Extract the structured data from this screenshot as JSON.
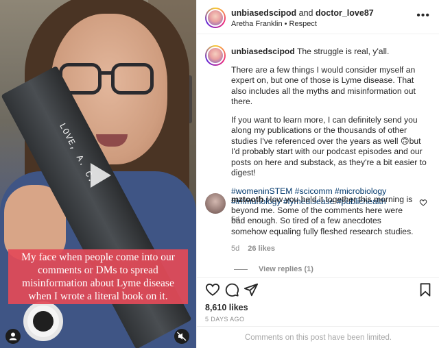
{
  "video": {
    "book_spine_text": "LOVE, A. C.",
    "caption_lines": [
      "My face when people come into our",
      "comments or DMs to spread",
      "misinformation about Lyme disease",
      "when I wrote a literal book on it."
    ]
  },
  "header": {
    "author_1": "unbiasedscipod",
    "joiner": " and ",
    "author_2": "doctor_love87",
    "audio": "Aretha Franklin • Respect",
    "more": "•••"
  },
  "caption_comment": {
    "username": "unbiasedscipod",
    "first_line": "The struggle is real, y'all.",
    "para_2": "There are a few things I would consider myself an expert on, but one of those is Lyme disease. That also includes all the myths and misinformation out there.",
    "para_3": "If you want to learn more, I can definitely send you along my publications or the thousands of other studies I've referenced over the years as well 🙃but I'd probably start with our podcast episodes and our posts on here and substack, as they're a bit easier to digest!",
    "hashtags": "#womeninSTEM #scicomm #microbiology #immunology #lymedisease #publichealth",
    "age": "5d"
  },
  "comment_1": {
    "username": "mztooth",
    "text": "How you held it together this morning is beyond me. Some of the comments here were bad enough. So tired of a few anecdotes somehow equaling fully fleshed research studies.",
    "age": "5d",
    "likes": "26 likes",
    "view_replies": "View replies (1)"
  },
  "actions": {
    "likes_count": "8,610 likes",
    "date": "5 DAYS AGO",
    "limited_notice": "Comments on this post have been limited."
  },
  "icons": {
    "play": "play-icon",
    "user_tag": "person-icon",
    "mute": "muted-speaker-icon",
    "like": "heart-icon",
    "comment": "comment-bubble-icon",
    "share": "paper-plane-icon",
    "save": "bookmark-icon"
  },
  "colors": {
    "caption_bg": "#e24a58",
    "hashtag": "#00376b",
    "muted_text": "#8e8e8e"
  }
}
